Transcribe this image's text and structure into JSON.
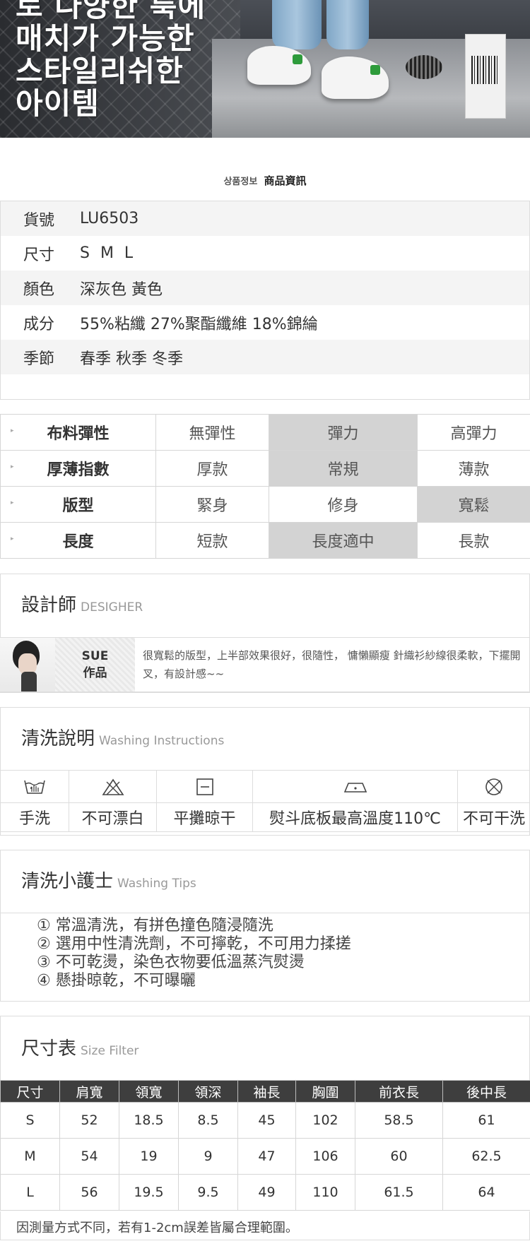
{
  "hero": {
    "lines": [
      "로 다양한 룩에",
      "매치가 가능한",
      "스타일리쉬한",
      "아이템"
    ]
  },
  "product_info": {
    "heading_ko": "상품정보",
    "heading_zh": "商品資訊",
    "rows": [
      {
        "label": "貨號",
        "value": "LU6503"
      },
      {
        "label": "尺寸",
        "value": "S M L"
      },
      {
        "label": "顏色",
        "value": "深灰色 黃色"
      },
      {
        "label": "成分",
        "value": "55%粘纖 27%聚酯纖維 18%錦綸"
      },
      {
        "label": "季節",
        "value": "春季 秋季 冬季"
      }
    ]
  },
  "attributes": [
    {
      "label": "布料彈性",
      "options": [
        "無彈性",
        "彈力",
        "高彈力"
      ],
      "selected": 1
    },
    {
      "label": "厚薄指數",
      "options": [
        "厚款",
        "常規",
        "薄款"
      ],
      "selected": 1
    },
    {
      "label": "版型",
      "options": [
        "緊身",
        "修身",
        "寬鬆"
      ],
      "selected": 2
    },
    {
      "label": "長度",
      "options": [
        "短款",
        "長度適中",
        "長款"
      ],
      "selected": 1
    }
  ],
  "designer": {
    "title": "設計師",
    "title_en": "DESIGHER",
    "name_line1": "SUE",
    "name_line2": "作品",
    "note": "很寬鬆的版型，上半部效果很好，很隨性， 慵懶顯瘦 針織衫紗線很柔軟，下擺開叉，有設計感~~"
  },
  "washing": {
    "title": "清洗說明",
    "title_en": "Washing Instructions",
    "items": [
      {
        "icon": "hand-wash-icon",
        "label": "手洗"
      },
      {
        "icon": "no-bleach-icon",
        "label": "不可漂白"
      },
      {
        "icon": "dry-flat-icon",
        "label": "平攤晾干"
      },
      {
        "icon": "iron-icon",
        "label": "熨斗底板最高溫度110℃"
      },
      {
        "icon": "no-dry-clean-icon",
        "label": "不可干洗"
      }
    ]
  },
  "tips": {
    "title": "清洗小護士",
    "title_en": "Washing Tips",
    "lines": [
      "① 常溫清洗，有拼色撞色隨浸隨洗",
      "② 選用中性清洗劑，不可擰乾，不可用力揉搓",
      "③ 不可乾燙，染色衣物要低溫蒸汽熨燙",
      "④ 懸掛晾乾，不可曝曬"
    ]
  },
  "size_chart": {
    "title": "尺寸表",
    "title_en": "Size Filter",
    "headers": [
      "尺寸",
      "肩寬",
      "領寬",
      "領深",
      "袖長",
      "胸圍",
      "前衣長",
      "後中長"
    ],
    "rows": [
      [
        "S",
        "52",
        "18.5",
        "8.5",
        "45",
        "102",
        "58.5",
        "61"
      ],
      [
        "M",
        "54",
        "19",
        "9",
        "47",
        "106",
        "60",
        "62.5"
      ],
      [
        "L",
        "56",
        "19.5",
        "9.5",
        "49",
        "110",
        "61.5",
        "64"
      ]
    ],
    "note": "因測量方式不同，若有1-2cm誤差皆屬合理範圍。"
  }
}
